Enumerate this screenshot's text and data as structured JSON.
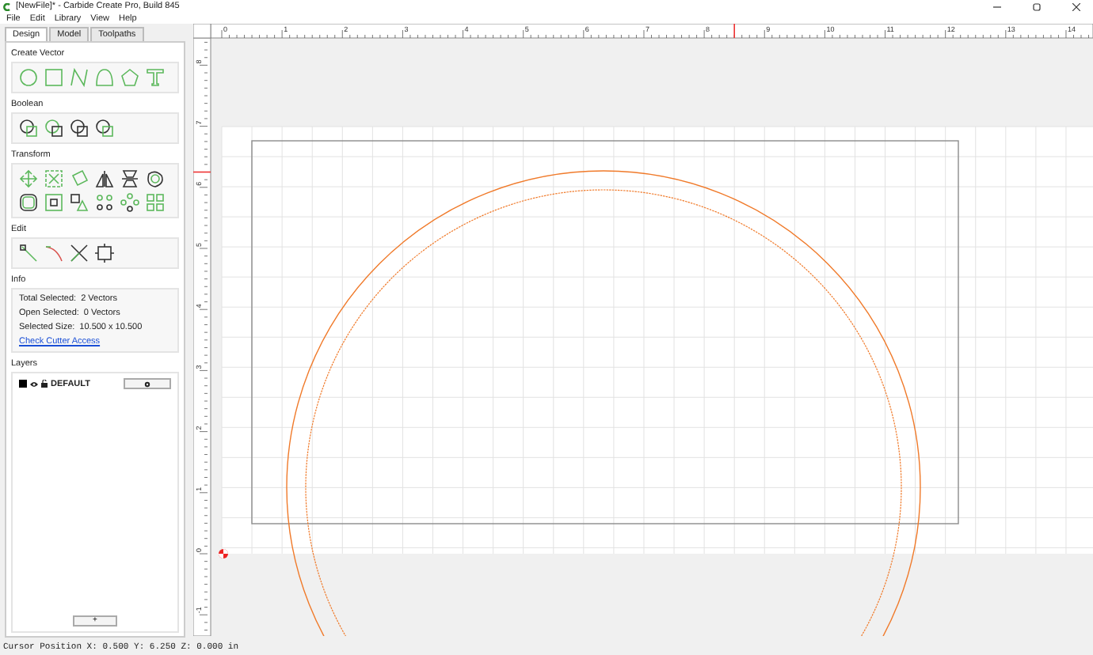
{
  "window": {
    "title": "[NewFile]* - Carbide Create Pro, Build 845"
  },
  "menu": [
    "File",
    "Edit",
    "Library",
    "View",
    "Help"
  ],
  "tabs": [
    {
      "label": "Design",
      "selected": true
    },
    {
      "label": "Model",
      "selected": false
    },
    {
      "label": "Toolpaths",
      "selected": false
    }
  ],
  "panels": [
    {
      "kind": "tools",
      "title": "Create Vector"
    },
    {
      "kind": "tools",
      "title": "Boolean"
    },
    {
      "kind": "tools",
      "title": "Transform"
    },
    {
      "kind": "tools",
      "title": "Edit"
    },
    {
      "kind": "info",
      "title": "Info",
      "rows": [
        {
          "label": "Total Selected:",
          "value": "2 Vectors"
        },
        {
          "label": "Open Selected:",
          "value": "0 Vectors"
        },
        {
          "label": "Selected Size:",
          "value": "10.500 x 10.500"
        }
      ],
      "link": "Check Cutter Access"
    },
    {
      "kind": "layers",
      "title": "Layers",
      "items": [
        {
          "name": "DEFAULT",
          "color": "#000000"
        }
      ],
      "add_button": "+"
    }
  ],
  "rulers": {
    "x_labels": [
      "0",
      "1",
      "2",
      "3",
      "4",
      "5",
      "6",
      "7",
      "8",
      "9",
      "10",
      "11",
      "12",
      "13",
      "14"
    ],
    "y_labels": [
      "8",
      "7",
      "6",
      "5",
      "4",
      "3",
      "2",
      "1",
      "0",
      "-1"
    ]
  },
  "status_bar": "Cursor Position X: 0.500 Y: 6.250 Z: 0.000 in"
}
